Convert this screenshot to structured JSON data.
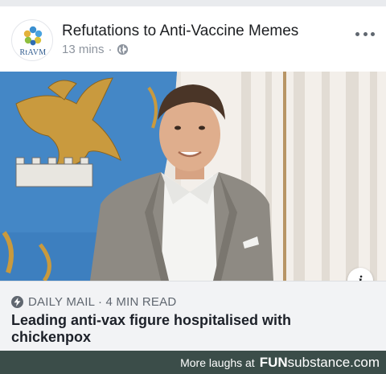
{
  "post": {
    "page_name": "Refutations to Anti-Vaccine Memes",
    "avatar_text": "RtAVM",
    "timestamp": "13 mins",
    "separator": "·",
    "privacy_icon": "globe-icon",
    "more_icon": "more-options-icon"
  },
  "link": {
    "source_icon": "lightning-bolt-icon",
    "source": "DAILY MAIL · 4 MIN READ",
    "headline": "Leading anti-vax figure hospitalised with chickenpox",
    "info_icon": "info-icon",
    "info_label": "i"
  },
  "footer": {
    "laughs": "More laughs at",
    "brand_part1": "FUN",
    "brand_part2": "substance",
    "brand_suffix": ".com"
  },
  "colors": {
    "background": "#e9ebee",
    "card": "#ffffff",
    "link_box": "#f2f3f5",
    "footer": "#3b4d49",
    "meta_text": "#8d949e"
  }
}
